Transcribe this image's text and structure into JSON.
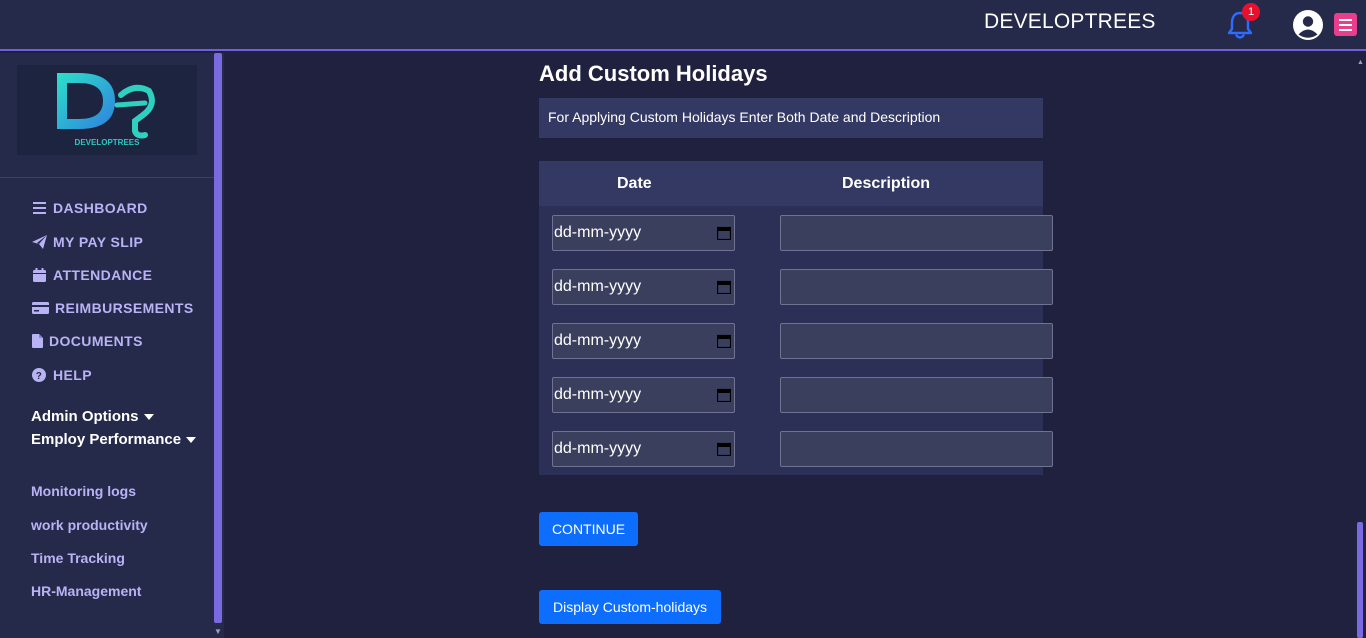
{
  "header": {
    "brand": "DEVELOPTREES",
    "notification_count": "1",
    "accent_color": "#6f5fd8"
  },
  "sidebar": {
    "logo_text": "DEVELOPTREES",
    "nav": [
      {
        "label": "DASHBOARD",
        "icon": "bars-icon"
      },
      {
        "label": "MY PAY SLIP",
        "icon": "paper-plane-icon"
      },
      {
        "label": "ATTENDANCE",
        "icon": "calendar-icon"
      },
      {
        "label": "REIMBURSEMENTS",
        "icon": "credit-card-icon"
      },
      {
        "label": "DOCUMENTS",
        "icon": "file-icon"
      },
      {
        "label": "HELP",
        "icon": "question-circle-icon"
      }
    ],
    "admin_options": "Admin Options",
    "employ_performance": "Employ Performance",
    "links": [
      "Monitoring logs",
      "work productivity",
      "Time Tracking",
      "HR-Management"
    ]
  },
  "main": {
    "title": "Add Custom Holidays",
    "info": "For Applying Custom Holidays Enter Both Date and Description",
    "table": {
      "headers": {
        "date": "Date",
        "description": "Description"
      },
      "rows": [
        {
          "date": "dd-mm-yyyy",
          "description": ""
        },
        {
          "date": "dd-mm-yyyy",
          "description": ""
        },
        {
          "date": "dd-mm-yyyy",
          "description": ""
        },
        {
          "date": "dd-mm-yyyy",
          "description": ""
        },
        {
          "date": "dd-mm-yyyy",
          "description": ""
        }
      ]
    },
    "continue_label": "CONTINUE",
    "display_label": "Display Custom-holidays",
    "button_color": "#0d6efd"
  }
}
